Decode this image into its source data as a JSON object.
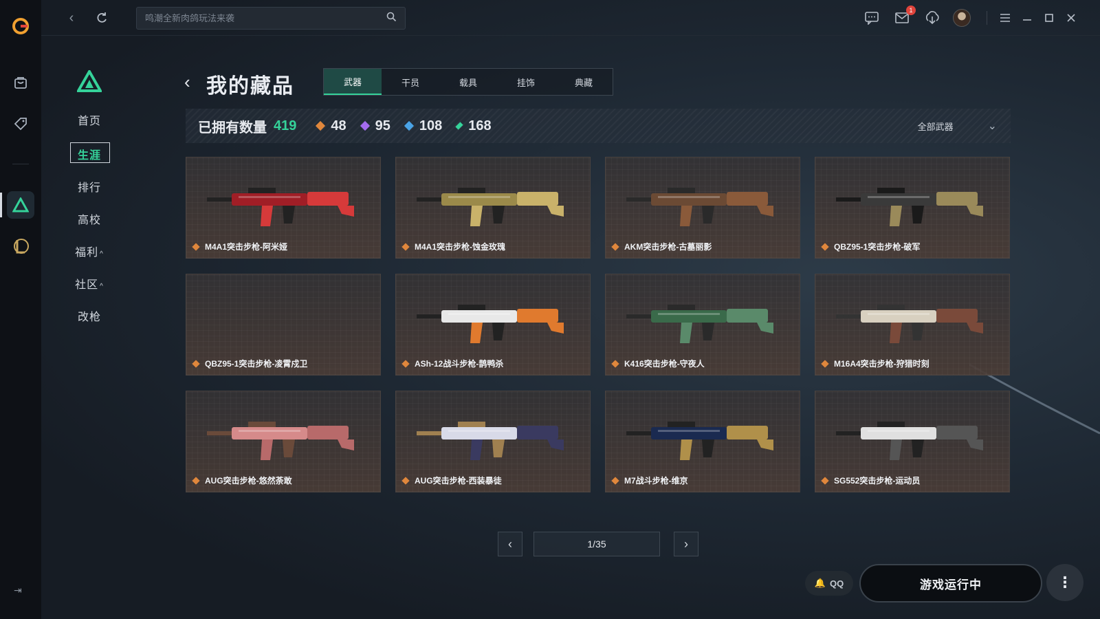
{
  "search": {
    "placeholder": "鸣潮全新肉鸽玩法来袭"
  },
  "header": {
    "mail_badge": "1"
  },
  "nav": {
    "items": [
      {
        "label": "首页"
      },
      {
        "label": "生涯"
      },
      {
        "label": "排行"
      },
      {
        "label": "高校"
      },
      {
        "label": "福利"
      },
      {
        "label": "社区"
      },
      {
        "label": "改枪"
      }
    ],
    "active": "生涯",
    "expand_icon": "caret-up"
  },
  "page": {
    "title": "我的藏品",
    "tabs": [
      {
        "label": "武器",
        "active": true
      },
      {
        "label": "干员",
        "active": false
      },
      {
        "label": "载具",
        "active": false
      },
      {
        "label": "挂饰",
        "active": false
      },
      {
        "label": "典藏",
        "active": false
      }
    ]
  },
  "stats": {
    "owned_label": "已拥有数量",
    "owned_total": "419",
    "tiers": [
      {
        "value": "48",
        "color": "#e0873c"
      },
      {
        "value": "95",
        "color": "#a56cf0"
      },
      {
        "value": "108",
        "color": "#4aa3e6"
      },
      {
        "value": "168",
        "color": "#35d39a"
      }
    ],
    "filter_label": "全部武器"
  },
  "items": [
    {
      "name": "M4A1突击步枪-阿米娅",
      "palette": [
        "#a01e26",
        "#d63a3a",
        "#222"
      ]
    },
    {
      "name": "M4A1突击步枪-蚀金玫瑰",
      "palette": [
        "#9b8a4a",
        "#c9b26a",
        "#222"
      ]
    },
    {
      "name": "AKM突击步枪-古墓丽影",
      "palette": [
        "#6b4a34",
        "#8a5a3a",
        "#2a2a2a"
      ]
    },
    {
      "name": "QBZ95-1突击步枪-破军",
      "palette": [
        "#3a3a3a",
        "#9a8a5a",
        "#1a1a1a"
      ]
    },
    {
      "name": "QBZ95-1突击步枪-凌霄戍卫",
      "palette": []
    },
    {
      "name": "ASh-12战斗步枪-鹊鸭杀",
      "palette": [
        "#e8e8e8",
        "#e07a2e",
        "#222"
      ]
    },
    {
      "name": "K416突击步枪-守夜人",
      "palette": [
        "#3a6a4a",
        "#5a8a6a",
        "#2a2a2a"
      ]
    },
    {
      "name": "M16A4突击步枪-狩猎时刻",
      "palette": [
        "#d8d0c0",
        "#7a4a3a",
        "#333"
      ]
    },
    {
      "name": "AUG突击步枪-悠然荼敢",
      "palette": [
        "#d68a8a",
        "#b86a6a",
        "#6a4a3a"
      ]
    },
    {
      "name": "AUG突击步枪-西装暴徒",
      "palette": [
        "#d8dae8",
        "#3a3a60",
        "#a08050"
      ]
    },
    {
      "name": "M7战斗步枪-维京",
      "palette": [
        "#1a2a50",
        "#b0904a",
        "#222"
      ]
    },
    {
      "name": "SG552突击步枪-运动员",
      "palette": [
        "#e0e0e0",
        "#555",
        "#222"
      ]
    }
  ],
  "pagination": {
    "label": "1/35"
  },
  "footer": {
    "qq_label": "QQ",
    "status_button": "游戏运行中"
  },
  "icons": {
    "rail": [
      "app-logo-icon",
      "bag-icon",
      "tag-icon",
      "game-delta-icon",
      "game-lol-icon",
      "collapse-icon"
    ],
    "topbar": [
      "back-icon",
      "refresh-icon",
      "search-icon",
      "chat-icon",
      "mail-icon",
      "download-icon",
      "avatar",
      "menu-icon",
      "minimize-icon",
      "maximize-icon",
      "close-icon"
    ]
  },
  "colors": {
    "accent": "#35d39a",
    "badge": "#e0443c"
  }
}
